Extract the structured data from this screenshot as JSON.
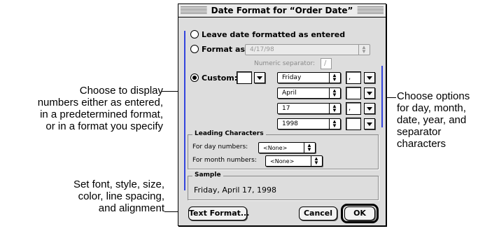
{
  "dialog": {
    "title": "Date Format for “Order Date”",
    "radio_leave_label": "Leave date formatted as entered",
    "radio_format_label": "Format as:",
    "format_as_value": "4/17/98",
    "numeric_separator_label": "Numeric separator:",
    "numeric_separator_value": "/",
    "radio_custom_label": "Custom:",
    "selected_option": "Custom",
    "custom_rows": [
      {
        "prefix": "",
        "value": "Friday",
        "separator": ","
      },
      {
        "value": "April",
        "separator": ""
      },
      {
        "value": "17",
        "separator": ","
      },
      {
        "value": "1998",
        "separator": ""
      }
    ],
    "leading": {
      "title": "Leading Characters",
      "day_label": "For day numbers:",
      "day_value": "<None>",
      "month_label": "For month numbers:",
      "month_value": "<None>"
    },
    "sample": {
      "title": "Sample",
      "text": "Friday, April 17, 1998"
    },
    "buttons": {
      "text_format": "Text Format...",
      "cancel": "Cancel",
      "ok": "OK"
    }
  },
  "callouts": {
    "left_top": "Choose to display\nnumbers either as entered,\nin a predetermined format,\nor in a format you specify",
    "left_bottom": "Set font, style, size,\ncolor, line spacing,\nand alignment",
    "right": "Choose options\nfor day, month,\ndate, year, and\nseparator\ncharacters"
  },
  "colors": {
    "bracket": "#3344dd",
    "dialog_bg": "#dddddd"
  }
}
